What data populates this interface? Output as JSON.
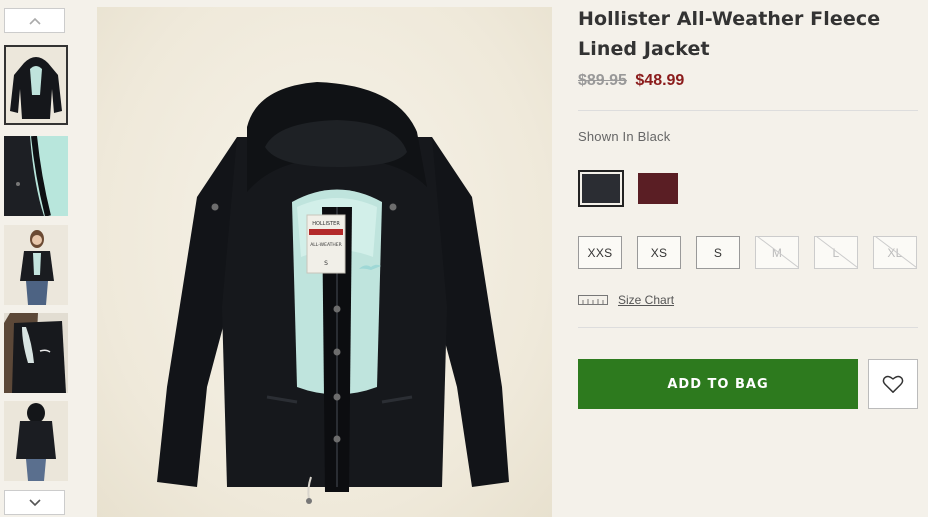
{
  "product": {
    "title": "Hollister All-Weather Fleece Lined Jacket",
    "price_original": "$89.95",
    "price_sale": "$48.99",
    "shown_in": "Shown In Black"
  },
  "colors": {
    "price_sale": "#8b1c1c",
    "add_to_bag": "#2d7a1e",
    "swatches": [
      {
        "name": "black",
        "hex": "#2b2d33",
        "selected": true
      },
      {
        "name": "burgundy",
        "hex": "#5a1e24",
        "selected": false
      }
    ]
  },
  "sizes": [
    {
      "label": "XXS",
      "available": true
    },
    {
      "label": "XS",
      "available": true
    },
    {
      "label": "S",
      "available": true
    },
    {
      "label": "M",
      "available": false
    },
    {
      "label": "L",
      "available": false
    },
    {
      "label": "XL",
      "available": false
    }
  ],
  "size_chart": {
    "label": "Size Chart",
    "icon": "ruler-icon"
  },
  "actions": {
    "add_to_bag": "ADD TO BAG",
    "wishlist_icon": "heart-icon"
  },
  "gallery": {
    "nav_up_icon": "chevron-up-icon",
    "nav_down_icon": "chevron-down-icon",
    "thumbnails": [
      "front-view",
      "lining-detail",
      "model-front",
      "model-side",
      "model-back"
    ],
    "selected_thumbnail": 0,
    "main_label": {
      "brand": "HOLLISTER",
      "sub": "ALL-WEATHER",
      "size": "S"
    }
  }
}
